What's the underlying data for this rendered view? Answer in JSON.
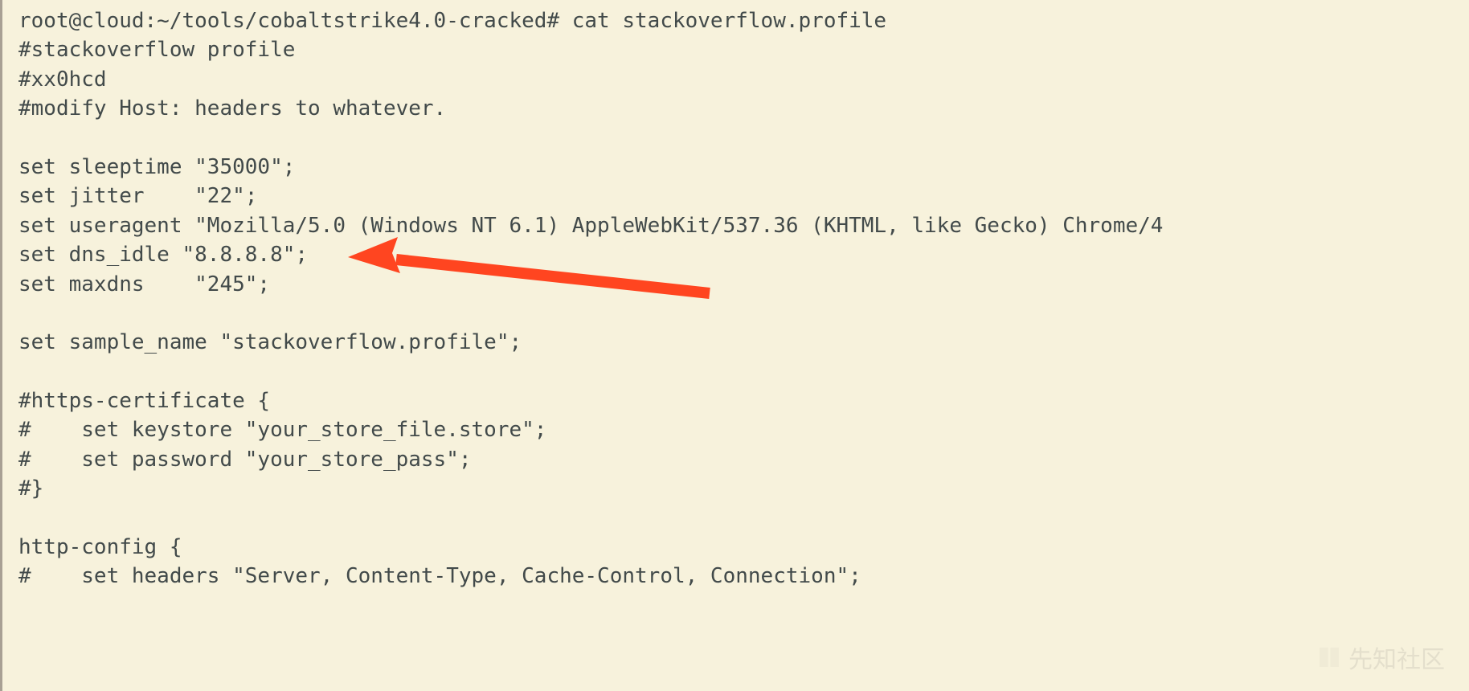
{
  "terminal": {
    "lines": [
      "root@cloud:~/tools/cobaltstrike4.0-cracked# cat stackoverflow.profile",
      "#stackoverflow profile",
      "#xx0hcd",
      "#modify Host: headers to whatever.",
      "",
      "set sleeptime \"35000\";",
      "set jitter    \"22\";",
      "set useragent \"Mozilla/5.0 (Windows NT 6.1) AppleWebKit/537.36 (KHTML, like Gecko) Chrome/4",
      "set dns_idle \"8.8.8.8\";",
      "set maxdns    \"245\";",
      "",
      "set sample_name \"stackoverflow.profile\";",
      "",
      "#https-certificate {",
      "#    set keystore \"your_store_file.store\";",
      "#    set password \"your_store_pass\";",
      "#}",
      "",
      "http-config {",
      "#    set headers \"Server, Content-Type, Cache-Control, Connection\";"
    ]
  },
  "annotation": {
    "arrow_color": "#ff4520"
  },
  "watermark": {
    "text": "先知社区"
  }
}
